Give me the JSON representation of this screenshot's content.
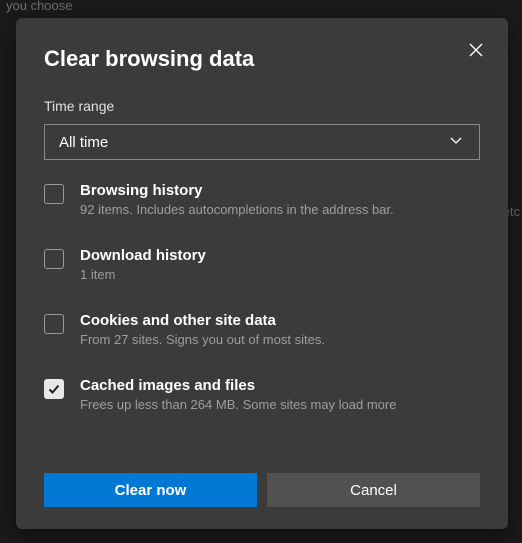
{
  "backgrounds": {
    "top_text": "you choose",
    "right_text": "etc"
  },
  "dialog": {
    "title": "Clear browsing data",
    "time_range_label": "Time range",
    "time_range_value": "All time",
    "options": [
      {
        "checked": false,
        "title": "Browsing history",
        "desc": "92 items. Includes autocompletions in the address bar."
      },
      {
        "checked": false,
        "title": "Download history",
        "desc": "1 item"
      },
      {
        "checked": false,
        "title": "Cookies and other site data",
        "desc": "From 27 sites. Signs you out of most sites."
      },
      {
        "checked": true,
        "title": "Cached images and files",
        "desc": "Frees up less than 264 MB. Some sites may load more"
      }
    ],
    "buttons": {
      "primary": "Clear now",
      "secondary": "Cancel"
    }
  }
}
